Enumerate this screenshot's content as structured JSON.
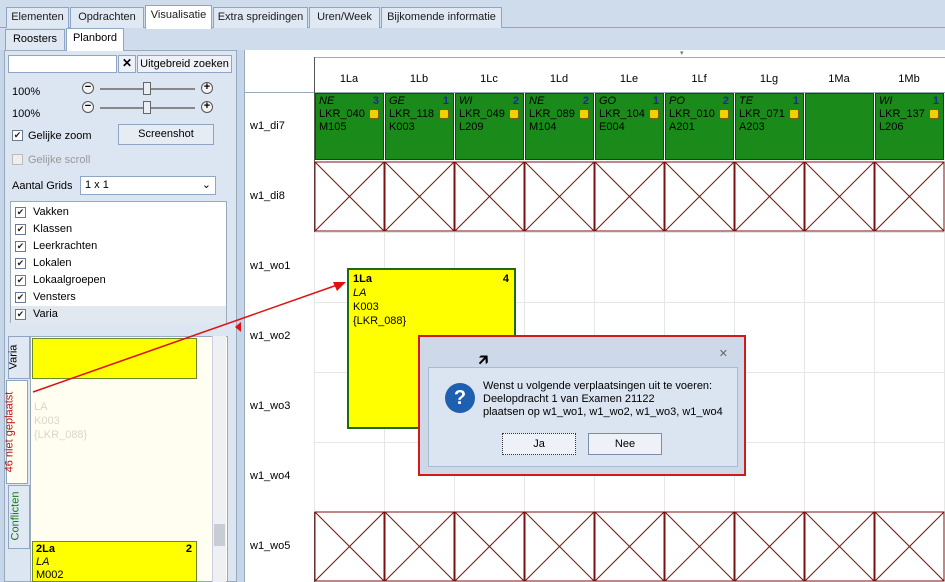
{
  "top_tabs": [
    {
      "label": "Elementen"
    },
    {
      "label": "Opdrachten"
    },
    {
      "label": "Visualisatie"
    },
    {
      "label": "Extra spreidingen"
    },
    {
      "label": "Uren/Week"
    },
    {
      "label": "Bijkomende informatie"
    }
  ],
  "sub_tabs": [
    {
      "label": "Roosters"
    },
    {
      "label": "Planbord"
    }
  ],
  "left": {
    "search_placeholder": "",
    "clear_label": "✕",
    "advanced_search_label": "Uitgebreid zoeken",
    "zoom1": "100%",
    "zoom2": "100%",
    "equal_zoom_label": "Gelijke zoom",
    "equal_zoom_checked": true,
    "screenshot_label": "Screenshot",
    "equal_scroll_label": "Gelijke scroll",
    "grids_label": "Aantal Grids",
    "grids_value": "1 x 1",
    "list": [
      {
        "label": "Vakken"
      },
      {
        "label": "Klassen"
      },
      {
        "label": "Leerkrachten"
      },
      {
        "label": "Lokalen"
      },
      {
        "label": "Lokaalgroepen"
      },
      {
        "label": "Vensters"
      },
      {
        "label": "Varia"
      }
    ],
    "vtabs": {
      "varia": "Varia",
      "unplaced": "46 niet geplaatst",
      "conflicts": "Conflicten"
    },
    "ghost": {
      "line1": "LA",
      "line2": "K003",
      "line3": "{LKR_088}"
    },
    "card2": {
      "class": "2La",
      "count": "2",
      "subject": "LA",
      "room": "M002"
    }
  },
  "grid": {
    "columns": [
      "1La",
      "1Lb",
      "1Lc",
      "1Ld",
      "1Le",
      "1Lf",
      "1Lg",
      "1Ma",
      "1Mb"
    ],
    "rows": [
      "w1_di7",
      "w1_di8",
      "w1_wo1",
      "w1_wo2",
      "w1_wo3",
      "w1_wo4",
      "w1_wo5"
    ],
    "row1_cells": [
      {
        "subject": "NE",
        "n": "3",
        "teacher": "LKR_040",
        "room": "M105"
      },
      {
        "subject": "GE",
        "n": "1",
        "teacher": "LKR_118",
        "room": "K003"
      },
      {
        "subject": "WI",
        "n": "2",
        "teacher": "LKR_049",
        "room": "L209"
      },
      {
        "subject": "NE",
        "n": "2",
        "teacher": "LKR_089",
        "room": "M104"
      },
      {
        "subject": "GO",
        "n": "1",
        "teacher": "LKR_104",
        "room": "E004"
      },
      {
        "subject": "PO",
        "n": "2",
        "teacher": "LKR_010",
        "room": "A201"
      },
      {
        "subject": "TE",
        "n": "1",
        "teacher": "LKR_071",
        "room": "A203"
      },
      {
        "subject": "",
        "n": "",
        "teacher": "",
        "room": ""
      },
      {
        "subject": "WI",
        "n": "1",
        "teacher": "LKR_137",
        "room": "L206"
      }
    ],
    "drag_card": {
      "class": "1La",
      "count": "4",
      "subject": "LA",
      "room": "K003",
      "teacher": "{LKR_088}"
    }
  },
  "dialog": {
    "close": "✕",
    "line1": "Wenst u volgende verplaatsingen uit te voeren:",
    "line2": "Deelopdracht 1 van Examen 21122",
    "line3": "plaatsen op w1_wo1, w1_wo2, w1_wo3, w1_wo4",
    "yes": "Ja",
    "no": "Nee"
  },
  "colors": {
    "cell_green": "#1a8a1a",
    "card_yellow": "#ffff00",
    "dialog_border": "#d21a1a",
    "arrow": "#e01010"
  }
}
